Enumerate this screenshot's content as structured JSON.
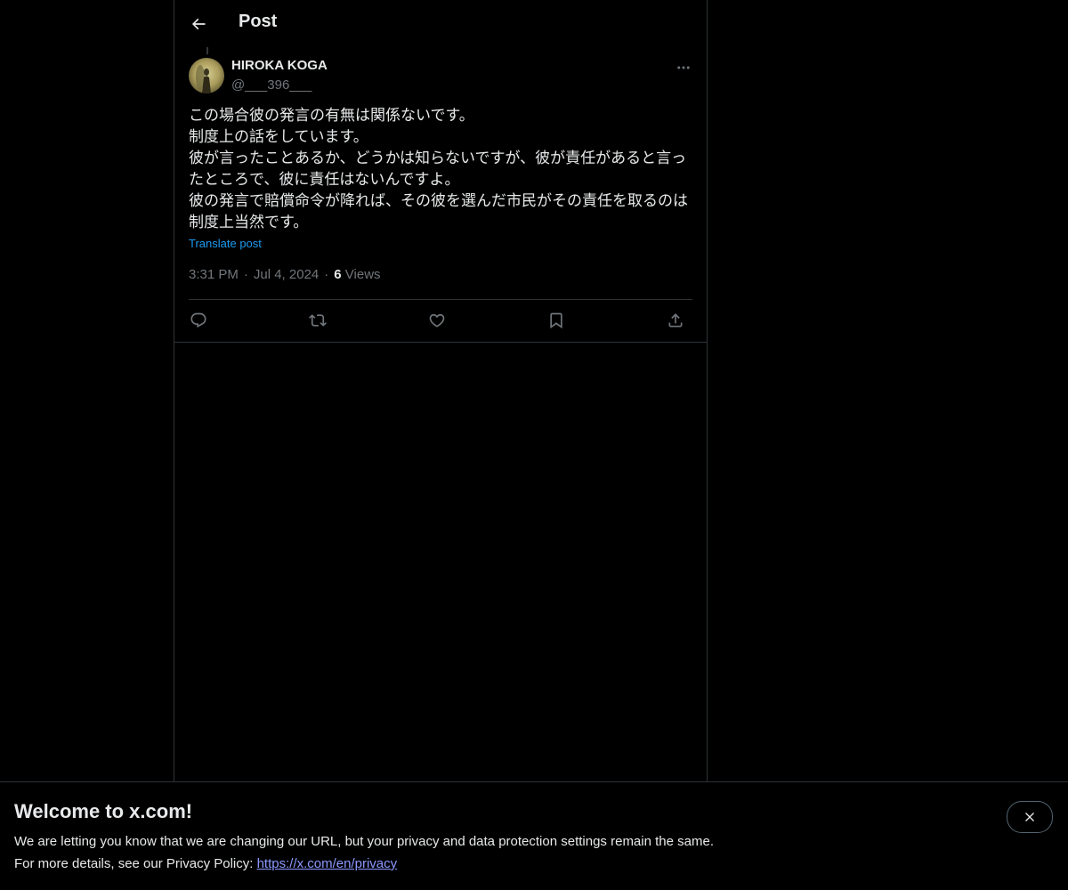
{
  "header": {
    "title": "Post",
    "back_icon": "arrow-left-icon"
  },
  "post": {
    "author": {
      "display_name": "HIROKA KOGA",
      "handle": "@___396___"
    },
    "text_lines": [
      "この場合彼の発言の有無は関係ないです。",
      "制度上の話をしています。",
      "彼が言ったことあるか、どうかは知らないですが、彼が責任があると言っ",
      "たところで、彼に責任はないんですよ。",
      "彼の発言で賠償命令が降れば、その彼を選んだ市民がその責任を取るのは",
      "制度上当然です。"
    ],
    "translate_label": "Translate post",
    "time": "3:31 PM",
    "separator": "·",
    "date": "Jul 4, 2024",
    "views_count": "6",
    "views_label": "Views"
  },
  "actions": [
    {
      "name": "reply-icon"
    },
    {
      "name": "repost-icon"
    },
    {
      "name": "like-icon"
    },
    {
      "name": "bookmark-icon"
    },
    {
      "name": "share-icon"
    }
  ],
  "banner": {
    "title": "Welcome to x.com!",
    "line1": "We are letting you know that we are changing our URL, but your privacy and data protection settings remain the same.",
    "line2_prefix": "For more details, see our Privacy Policy: ",
    "privacy_link": "https://x.com/en/privacy"
  },
  "colors": {
    "background": "#000000",
    "text": "#e7e9ea",
    "muted": "#71767b",
    "accent": "#1d9bf0",
    "border": "#2f3336"
  }
}
